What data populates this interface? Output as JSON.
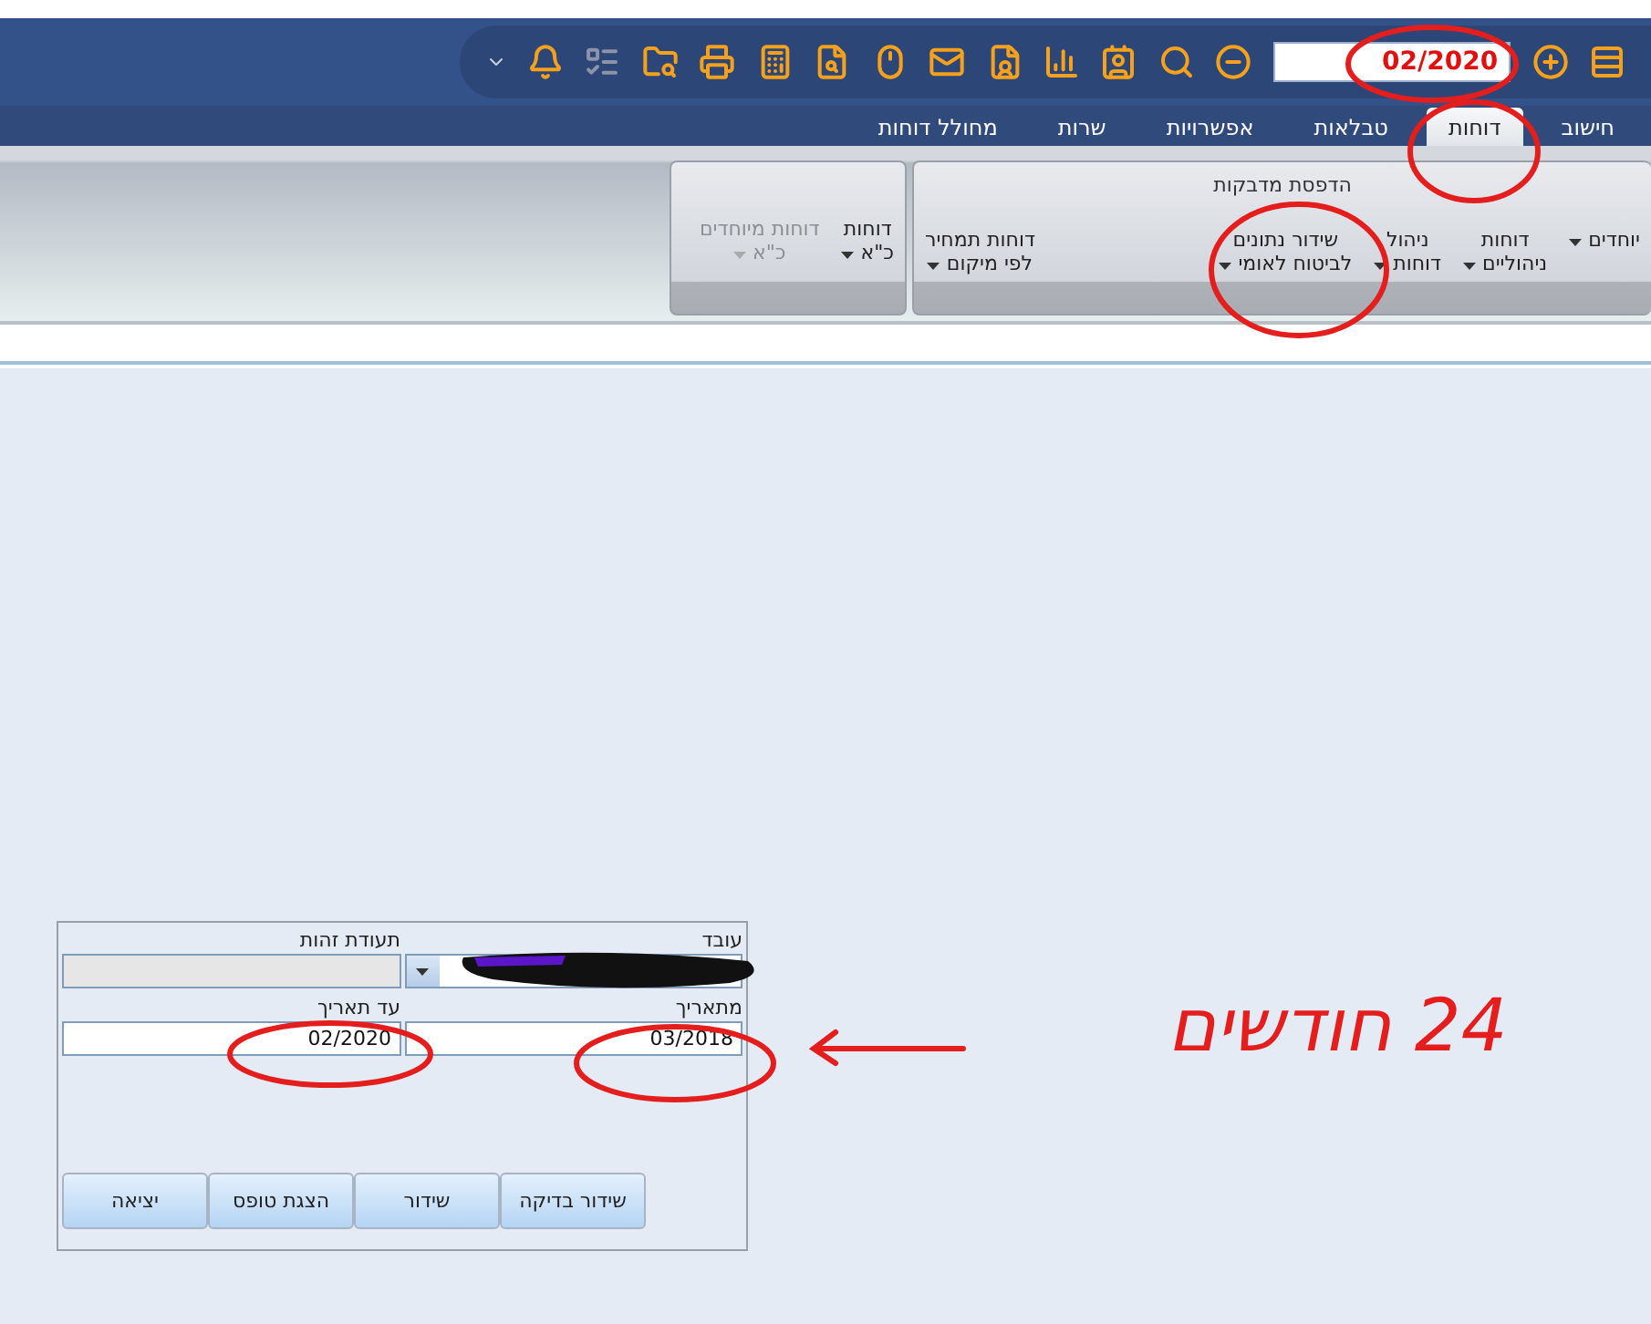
{
  "toolbar": {
    "date_value": "02/2020"
  },
  "tabs": [
    {
      "label": "חישוב",
      "selected": false
    },
    {
      "label": "דוחות",
      "selected": true
    },
    {
      "label": "טבלאות",
      "selected": false
    },
    {
      "label": "אפשרויות",
      "selected": false
    },
    {
      "label": "שרות",
      "selected": false
    },
    {
      "label": "מחולל דוחות",
      "selected": false
    }
  ],
  "ribbon": {
    "groups": [
      {
        "title": "הדפסת מדבקות",
        "items": [
          {
            "lines": [
              "יוחדים"
            ],
            "disabled": false
          },
          {
            "lines": [
              "דוחות",
              "ניהוליים"
            ],
            "disabled": false
          },
          {
            "lines": [
              "ניהול",
              "דוחות"
            ],
            "disabled": false
          },
          {
            "lines": [
              "שידור נתונים",
              "לביטוח לאומי"
            ],
            "disabled": false
          },
          {
            "lines": [
              "דוחות תמחיר",
              "לפי מיקום"
            ],
            "disabled": false
          }
        ]
      },
      {
        "items": [
          {
            "lines": [
              "דוחות",
              "כ\"א"
            ],
            "disabled": false
          },
          {
            "lines": [
              "דוחות מיוחדים",
              "כ\"א"
            ],
            "disabled": true
          }
        ]
      }
    ]
  },
  "dialog": {
    "employee_label": "עובד",
    "id_label": "תעודת זהות",
    "from_label": "מתאריך",
    "from_value": "03/2018",
    "to_label": "עד תאריך",
    "to_value": "02/2020",
    "buttons": [
      "שידור בדיקה",
      "שידור",
      "הצגת טופס",
      "יציאה"
    ]
  },
  "annotation": {
    "note": "24 חודשים"
  }
}
